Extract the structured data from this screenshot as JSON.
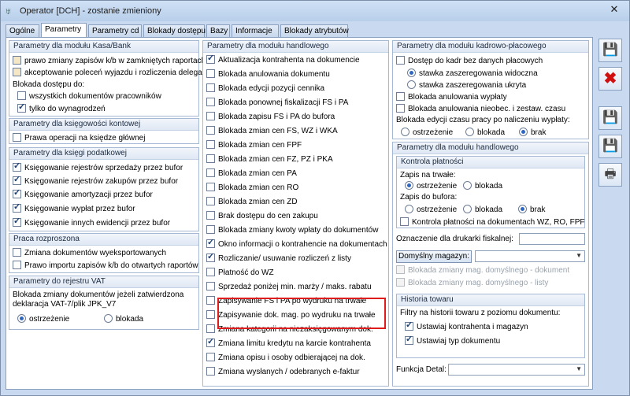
{
  "window": {
    "title": "Operator [DCH] - zostanie zmieniony",
    "close_label": "✕"
  },
  "tabs": [
    "Ogólne",
    "Parametry",
    "Parametry cd",
    "Blokady dostępu",
    "Bazy",
    "Informacje",
    "Blokady atrybutów"
  ],
  "active_tab": "Parametry",
  "kasa_bank": {
    "title": "Parametry dla modułu Kasa/Bank",
    "items": [
      {
        "label": "prawo zmiany zapisów k/b w zamkniętych raportach",
        "checked": false
      },
      {
        "label": "akceptowanie poleceń wyjazdu i rozliczenia delegacji",
        "checked": false
      }
    ],
    "blokada_label": "Blokada dostępu do:",
    "blokada_items": [
      {
        "label": "wszystkich dokumentów pracowników",
        "checked": false
      },
      {
        "label": "tylko do wynagrodzeń",
        "checked": true
      }
    ]
  },
  "ksiegowosc_kontowa": {
    "title": "Parametry dla księgowości kontowej",
    "items": [
      {
        "label": "Prawa operacji na księdze głównej",
        "checked": false
      }
    ]
  },
  "ksiega_podatkowa": {
    "title": "Parametry dla księgi podatkowej",
    "items": [
      {
        "label": "Księgowanie rejestrów sprzedaży przez bufor",
        "checked": true
      },
      {
        "label": "Księgowanie rejestrów zakupów przez bufor",
        "checked": true
      },
      {
        "label": "Księgowanie amortyzacji przez bufor",
        "checked": true
      },
      {
        "label": "Księgowanie wypłat przez bufor",
        "checked": true
      },
      {
        "label": "Księgowanie innych ewidencji przez bufor",
        "checked": true
      }
    ]
  },
  "praca_rozproszona": {
    "title": "Praca rozproszona",
    "items": [
      {
        "label": "Zmiana dokumentów wyeksportowanych",
        "checked": false
      },
      {
        "label": "Prawo importu zapisów k/b do otwartych raportów",
        "checked": false
      }
    ]
  },
  "rejestr_vat": {
    "title": "Parametry do rejestru VAT",
    "desc_line1": "Blokada zmiany dokumentów jeżeli zatwierdzona",
    "desc_line2": "deklaracja VAT-7/plik JPK_V7",
    "radios": [
      {
        "label": "ostrzeżenie",
        "checked": true
      },
      {
        "label": "blokada",
        "checked": false
      }
    ]
  },
  "handlowy": {
    "title": "Parametry dla modułu handlowego",
    "items": [
      {
        "label": "Aktualizacja kontrahenta na dokumencie",
        "checked": true
      },
      {
        "label": "Blokada anulowania dokumentu",
        "checked": false
      },
      {
        "label": "Blokada edycji pozycji cennika",
        "checked": false
      },
      {
        "label": "Blokada ponownej fiskalizacji FS i PA",
        "checked": false
      },
      {
        "label": "Blokada zapisu FS i PA do bufora",
        "checked": false
      },
      {
        "label": "Blokada zmian cen FS, WZ i WKA",
        "checked": false
      },
      {
        "label": "Blokada zmian cen FPF",
        "checked": false
      },
      {
        "label": "Blokada zmian cen FZ, PZ i PKA",
        "checked": false
      },
      {
        "label": "Blokada zmian cen PA",
        "checked": false
      },
      {
        "label": "Blokada zmian cen RO",
        "checked": false
      },
      {
        "label": "Blokada zmian cen ZD",
        "checked": false
      },
      {
        "label": "Brak dostępu do cen zakupu",
        "checked": false
      },
      {
        "label": "Blokada zmiany kwoty wpłaty do dokumentów",
        "checked": false
      },
      {
        "label": "Okno informacji o kontrahencie na dokumentach",
        "checked": true
      },
      {
        "label": "Rozliczanie/ usuwanie rozliczeń z listy",
        "checked": true
      },
      {
        "label": "Płatność do WZ",
        "checked": false
      },
      {
        "label": "Sprzedaż poniżej min. marży / maks. rabatu",
        "checked": false
      },
      {
        "label": "Zapisywanie FS i PA po wydruku na trwałe",
        "checked": false
      },
      {
        "label": "Zapisywanie dok. mag. po wydruku na trwałe",
        "checked": false
      },
      {
        "label": "Zmiana kategorii na niezaksięgowanym dok.",
        "checked": false
      },
      {
        "label": "Zmiana limitu kredytu na karcie kontrahenta",
        "checked": true
      },
      {
        "label": "Zmiana opisu i osoby odbierającej na dok.",
        "checked": false
      },
      {
        "label": "Zmiana wysłanych / odebranych e-faktur",
        "checked": false
      }
    ]
  },
  "kadrowo_placowy": {
    "title": "Parametry dla modułu kadrowo-płacowego",
    "dostep_label": "Dostęp do kadr bez danych płacowych",
    "dostep_checked": false,
    "stawka_radios": [
      {
        "label": "stawka zaszeregowania widoczna",
        "checked": true
      },
      {
        "label": "stawka zaszeregowania ukryta",
        "checked": false
      }
    ],
    "items": [
      {
        "label": "Blokada anulowania wypłaty",
        "checked": false
      },
      {
        "label": "Blokada anulowania nieobec. i zestaw. czasu",
        "checked": false
      }
    ],
    "edycja_label": "Blokada edycji czasu pracy po naliczeniu wypłaty:",
    "edycja_radios": [
      {
        "label": "ostrzeżenie",
        "checked": false
      },
      {
        "label": "blokada",
        "checked": false
      },
      {
        "label": "brak",
        "checked": true
      }
    ]
  },
  "handlowy_right": {
    "title": "Parametry dla modułu handlowego",
    "kontrola_title": "Kontrola płatności",
    "zapis_trwale_label": "Zapis na trwałe:",
    "zapis_trwale_radios": [
      {
        "label": "ostrzeżenie",
        "checked": true
      },
      {
        "label": "blokada",
        "checked": false
      }
    ],
    "zapis_bufora_label": "Zapis do bufora:",
    "zapis_bufora_radios": [
      {
        "label": "ostrzeżenie",
        "checked": false
      },
      {
        "label": "blokada",
        "checked": false
      },
      {
        "label": "brak",
        "checked": true
      }
    ],
    "kontrola_wz_label": "Kontrola płatności na dokumentach WZ, RO, FPF",
    "kontrola_wz_checked": false,
    "oznaczenie_label": "Oznaczenie dla drukarki fiskalnej:",
    "oznaczenie_value": "",
    "magazyn_button": "Domyślny magazyn:",
    "magazyn_value": "",
    "blokada_mag_dok": "Blokada zmiany mag. domyślnego - dokument",
    "blokada_mag_listy": "Blokada zmiany mag. domyślnego - listy",
    "historia_title": "Historia towaru",
    "historia_desc": "Filtry na historii towaru z poziomu dokumentu:",
    "historia_items": [
      {
        "label": "Ustawiaj kontrahenta i magazyn",
        "checked": true
      },
      {
        "label": "Ustawiaj typ dokumentu",
        "checked": true
      }
    ],
    "funkcja_label": "Funkcja Detal:",
    "funkcja_value": ""
  },
  "side_buttons": [
    "save-icon",
    "cancel-icon",
    "save-and-next-icon",
    "save-and-next-2-icon",
    "print-icon"
  ],
  "colors": {
    "highlight": "#e01b1b",
    "window_bg": "#c9daf0"
  }
}
